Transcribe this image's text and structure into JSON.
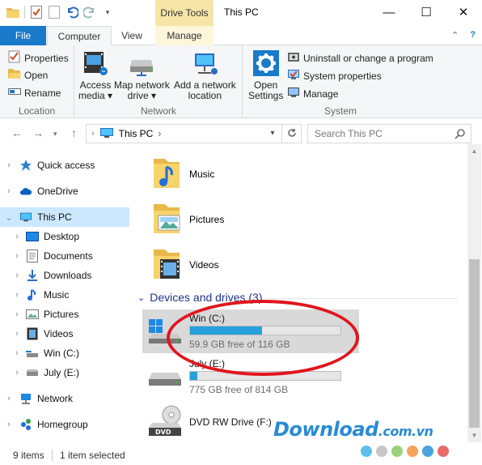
{
  "window": {
    "title": "This PC",
    "context_tab_group": "Drive Tools",
    "minimize": "—",
    "maximize": "☐",
    "close": "✕"
  },
  "ribbon_tabs": [
    {
      "label": "File"
    },
    {
      "label": "Computer"
    },
    {
      "label": "View"
    },
    {
      "label": "Manage"
    }
  ],
  "ribbon_tabs_right": {
    "collapse": "⌃",
    "help": "?"
  },
  "ribbon": {
    "location": {
      "label": "Location",
      "buttons": [
        {
          "label": "Properties",
          "icon": "properties-icon"
        },
        {
          "label": "Open",
          "icon": "open-icon"
        },
        {
          "label": "Rename",
          "icon": "rename-icon"
        }
      ]
    },
    "network": {
      "label": "Network",
      "buttons": [
        {
          "label_line1": "Access",
          "label_line2": "media ▾",
          "icon": "access-media-icon"
        },
        {
          "label_line1": "Map network",
          "label_line2": "drive ▾",
          "icon": "map-network-drive-icon"
        },
        {
          "label_line1": "Add a network",
          "label_line2": "location",
          "icon": "add-network-location-icon"
        }
      ]
    },
    "system": {
      "label": "System",
      "open_settings": {
        "label_line1": "Open",
        "label_line2": "Settings",
        "icon": "settings-gear-icon"
      },
      "buttons": [
        {
          "label": "Uninstall or change a program",
          "icon": "uninstall-icon"
        },
        {
          "label": "System properties",
          "icon": "system-properties-icon"
        },
        {
          "label": "Manage",
          "icon": "manage-icon"
        }
      ]
    }
  },
  "address": {
    "path": "This PC",
    "separator": "›",
    "search_placeholder": "Search This PC"
  },
  "nav_pane": [
    {
      "label": "Quick access",
      "icon": "star-icon",
      "level": 0,
      "expanded": false
    },
    {
      "label": "OneDrive",
      "icon": "cloud-icon",
      "level": 0,
      "expanded": false
    },
    {
      "label": "This PC",
      "icon": "monitor-icon",
      "level": 0,
      "expanded": true,
      "selected": true
    },
    {
      "label": "Desktop",
      "icon": "desktop-icon",
      "level": 1
    },
    {
      "label": "Documents",
      "icon": "documents-icon",
      "level": 1
    },
    {
      "label": "Downloads",
      "icon": "downloads-icon",
      "level": 1
    },
    {
      "label": "Music",
      "icon": "music-icon",
      "level": 1
    },
    {
      "label": "Pictures",
      "icon": "pictures-icon",
      "level": 1
    },
    {
      "label": "Videos",
      "icon": "videos-icon",
      "level": 1
    },
    {
      "label": "Win (C:)",
      "icon": "drive-icon",
      "level": 1
    },
    {
      "label": "July (E:)",
      "icon": "drive-icon",
      "level": 1
    },
    {
      "label": "Network",
      "icon": "network-icon",
      "level": 0
    },
    {
      "label": "Homegroup",
      "icon": "homegroup-icon",
      "level": 0
    }
  ],
  "folders": [
    {
      "label": "Music",
      "icon": "music-folder-icon"
    },
    {
      "label": "Pictures",
      "icon": "pictures-folder-icon"
    },
    {
      "label": "Videos",
      "icon": "videos-folder-icon"
    }
  ],
  "devices": {
    "heading": "Devices and drives (3)",
    "drives": [
      {
        "name": "Win (C:)",
        "free_text": "59.9 GB free of 116 GB",
        "used_fraction": 0.48,
        "selected": true,
        "icon": "windows-drive-icon"
      },
      {
        "name": "July (E:)",
        "free_text": "775 GB free of 814 GB",
        "used_fraction": 0.05,
        "selected": false,
        "icon": "hard-drive-icon"
      },
      {
        "name": "DVD RW Drive (F:)",
        "free_text": "",
        "selected": false,
        "icon": "dvd-drive-icon"
      }
    ]
  },
  "status_bar": {
    "item_count": "9 items",
    "selection": "1 item selected"
  },
  "watermark": {
    "brand": "Download",
    "suffix": ".com.vn"
  },
  "colors": {
    "accent": "#1979ca",
    "selection": "#cce8ff",
    "progress": "#26a0da",
    "highlight": "#e0161d",
    "section_heading": "#1e3287",
    "context_tab": "#f5e6a8"
  }
}
